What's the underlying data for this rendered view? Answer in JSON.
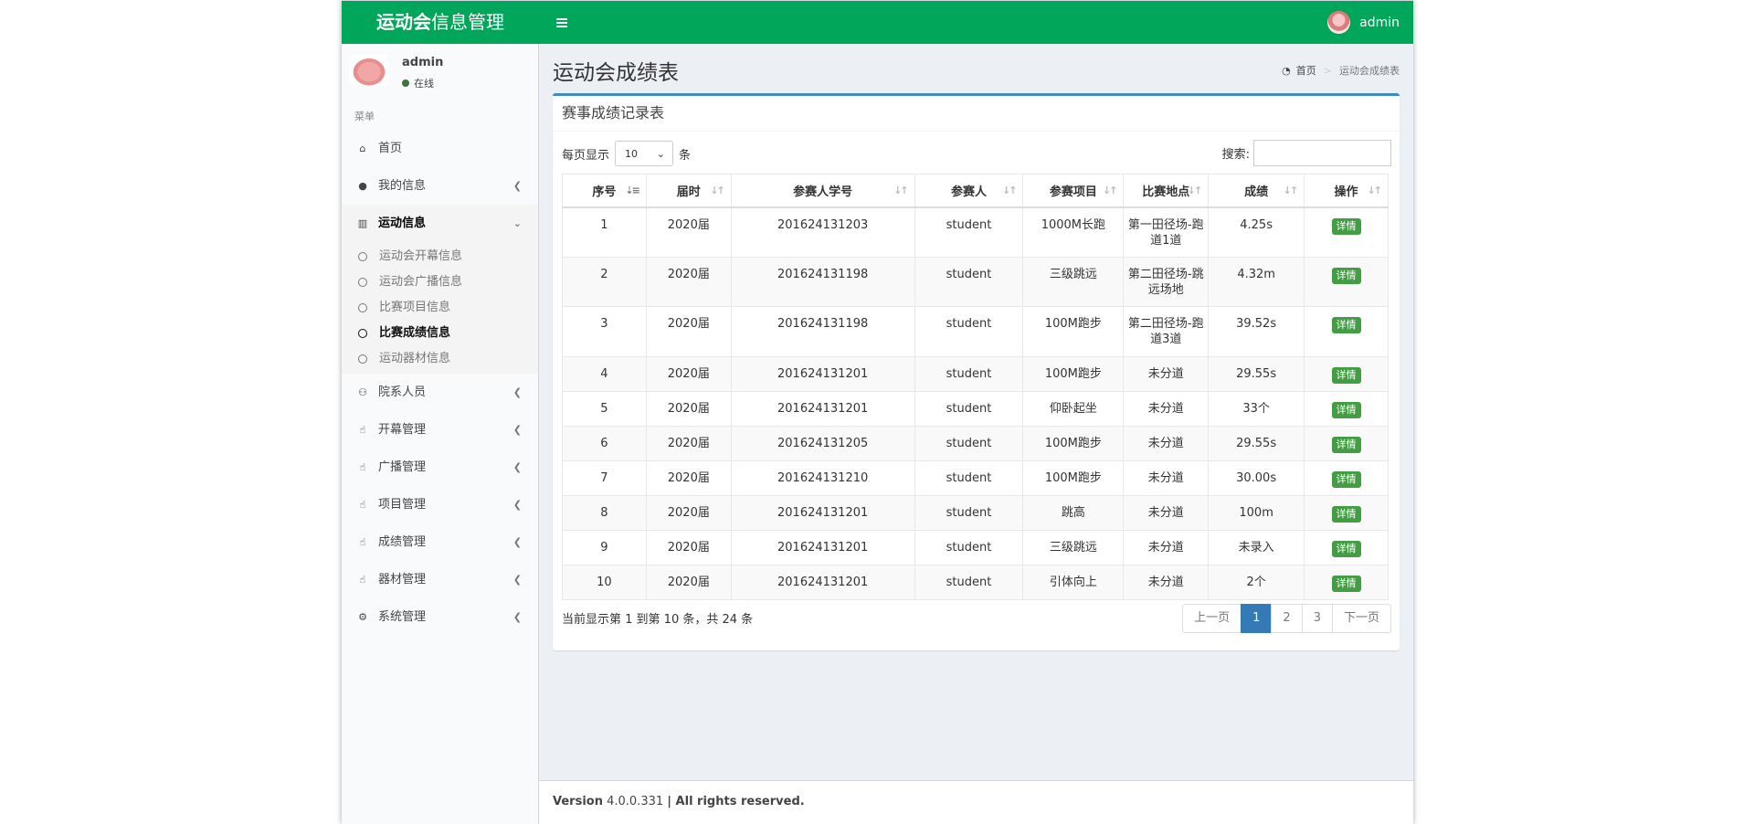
{
  "header": {
    "logo_bold": "运动会",
    "logo_light": "信息管理",
    "toggle_icon": "bars-icon",
    "user_name": "admin"
  },
  "sidebar": {
    "user": {
      "name": "admin",
      "status": "在线"
    },
    "menu_header": "菜单",
    "items": [
      {
        "label": "首页",
        "icon": "home-icon"
      },
      {
        "label": "我的信息",
        "icon": "user-icon"
      },
      {
        "label": "运动信息",
        "icon": "bar-chart-icon"
      },
      {
        "label": "院系人员",
        "icon": "users-icon"
      },
      {
        "label": "开幕管理",
        "icon": "thumbs-up-icon"
      },
      {
        "label": "广播管理",
        "icon": "thumbs-up-icon"
      },
      {
        "label": "项目管理",
        "icon": "thumbs-up-icon"
      },
      {
        "label": "成绩管理",
        "icon": "thumbs-up-icon"
      },
      {
        "label": "器材管理",
        "icon": "thumbs-up-icon"
      },
      {
        "label": "系统管理",
        "icon": "gear-icon"
      }
    ],
    "sub_items": [
      {
        "label": "运动会开幕信息"
      },
      {
        "label": "运动会广播信息"
      },
      {
        "label": "比赛项目信息"
      },
      {
        "label": "比赛成绩信息",
        "active": true
      },
      {
        "label": "运动器材信息"
      }
    ]
  },
  "content": {
    "title": "运动会成绩表",
    "breadcrumb": {
      "home": "首页",
      "current": "运动会成绩表"
    }
  },
  "box": {
    "title": "赛事成绩记录表",
    "length": {
      "prefix": "每页显示",
      "value": "10",
      "suffix": "条"
    },
    "search_label": "搜索:",
    "search_value": ""
  },
  "table": {
    "columns": [
      "序号",
      "届时",
      "参赛人学号",
      "参赛人",
      "参赛项目",
      "比赛地点",
      "成绩",
      "操作"
    ],
    "rows": [
      [
        "1",
        "2020届",
        "201624131203",
        "student",
        "1000M长跑",
        "第一田径场-跑道1道",
        "4.25s"
      ],
      [
        "2",
        "2020届",
        "201624131198",
        "student",
        "三级跳远",
        "第二田径场-跳远场地",
        "4.32m"
      ],
      [
        "3",
        "2020届",
        "201624131198",
        "student",
        "100M跑步",
        "第二田径场-跑道3道",
        "39.52s"
      ],
      [
        "4",
        "2020届",
        "201624131201",
        "student",
        "100M跑步",
        "未分道",
        "29.55s"
      ],
      [
        "5",
        "2020届",
        "201624131201",
        "student",
        "仰卧起坐",
        "未分道",
        "33个"
      ],
      [
        "6",
        "2020届",
        "201624131205",
        "student",
        "100M跑步",
        "未分道",
        "29.55s"
      ],
      [
        "7",
        "2020届",
        "201624131210",
        "student",
        "100M跑步",
        "未分道",
        "30.00s"
      ],
      [
        "8",
        "2020届",
        "201624131201",
        "student",
        "跳高",
        "未分道",
        "100m"
      ],
      [
        "9",
        "2020届",
        "201624131201",
        "student",
        "三级跳远",
        "未分道",
        "未录入"
      ],
      [
        "10",
        "2020届",
        "201624131201",
        "student",
        "引体向上",
        "未分道",
        "2个"
      ]
    ],
    "action_label": "详情"
  },
  "footer_info": "当前显示第 1 到第 10 条，共 24 条",
  "pagination": {
    "prev": "上一页",
    "pages": [
      "1",
      "2",
      "3"
    ],
    "active": "1",
    "next": "下一页"
  },
  "footer": {
    "version_label": "Version",
    "version": "4.0.0.331",
    "rights": "| All rights reserved."
  },
  "colors": {
    "header": "#00a65a",
    "box_accent": "#3c8dbc",
    "detail_button": "#449d44",
    "page_active": "#337ab7"
  }
}
